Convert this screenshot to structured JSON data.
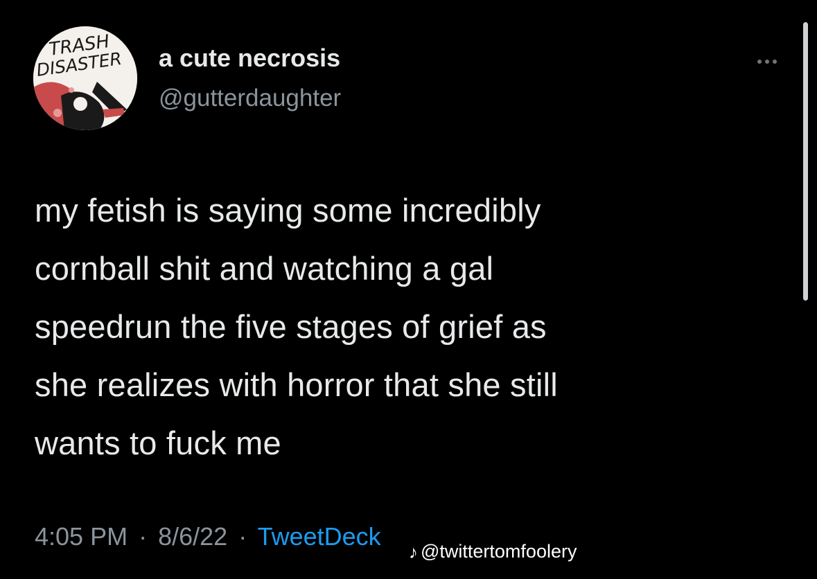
{
  "tweet": {
    "author": {
      "display_name": "a cute necrosis",
      "handle": "@gutterdaughter",
      "avatar_text_line1": "TRASH",
      "avatar_text_line2": "DISASTER"
    },
    "more_icon": "more-horizontal-icon",
    "text_lines": [
      "my fetish is saying some incredibly",
      "cornball shit and watching a gal",
      "speedrun the five stages of grief as",
      "she realizes with horror that she still",
      "wants to fuck me"
    ],
    "time": "4:05 PM",
    "date": "8/6/22",
    "separator": "·",
    "source": "TweetDeck"
  },
  "watermark": {
    "icon": "tiktok-icon",
    "text": "@twittertomfoolery"
  },
  "colors": {
    "background": "#000000",
    "text": "#e7e9ea",
    "muted": "#8b949c",
    "link": "#1d9bf0"
  }
}
